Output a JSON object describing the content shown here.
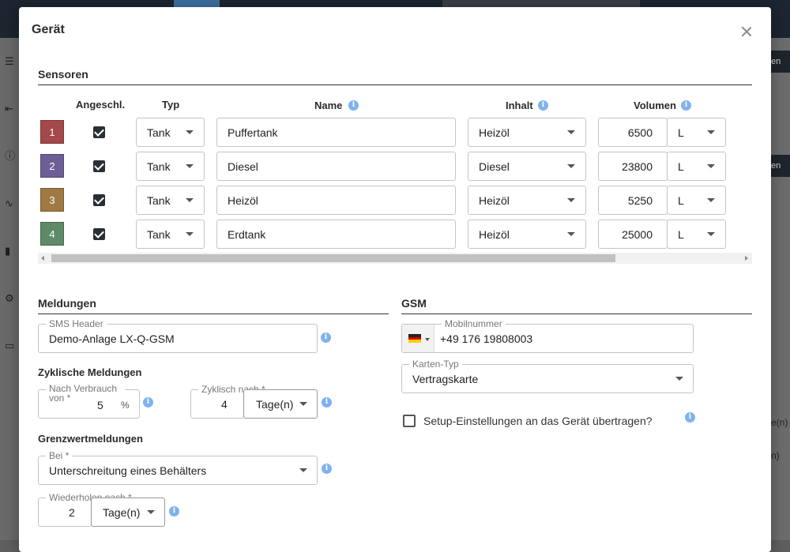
{
  "background": {
    "right_buttons": [
      "en",
      "en"
    ],
    "right_texts": [
      "e(n)",
      "n)"
    ],
    "sidebar_icons": [
      "list-icon",
      "collapse-icon",
      "info-icon",
      "trend-icon",
      "bar-chart-icon",
      "settings-icon",
      "screen-icon"
    ]
  },
  "dialog": {
    "title": "Gerät",
    "sensors": {
      "title": "Sensoren",
      "headers": {
        "connected": "Angeschl.",
        "type": "Typ",
        "name": "Name",
        "content": "Inhalt",
        "volume": "Volumen"
      },
      "rows": [
        {
          "number": "1",
          "color": "#a5484a",
          "connected": true,
          "type": "Tank",
          "name": "Puffertank",
          "content": "Heizöl",
          "volume": "6500",
          "unit": "L"
        },
        {
          "number": "2",
          "color": "#6e5e98",
          "connected": true,
          "type": "Tank",
          "name": "Diesel",
          "content": "Diesel",
          "volume": "23800",
          "unit": "L"
        },
        {
          "number": "3",
          "color": "#9e7a42",
          "connected": true,
          "type": "Tank",
          "name": "Heizöl",
          "content": "Heizöl",
          "volume": "5250",
          "unit": "L"
        },
        {
          "number": "4",
          "color": "#5f8a67",
          "connected": true,
          "type": "Tank",
          "name": "Erdtank",
          "content": "Heizöl",
          "volume": "25000",
          "unit": "L"
        }
      ]
    },
    "messages": {
      "title": "Meldungen",
      "sms_header": {
        "label": "SMS Header",
        "value": "Demo-Anlage LX-Q-GSM"
      },
      "cyclic": {
        "title": "Zyklische Meldungen",
        "after_consumption": {
          "label": "Nach Verbrauch von *",
          "value": "5",
          "unit": "%"
        },
        "cyclic_after": {
          "label": "Zyklisch nach *",
          "value": "4",
          "unit": "Tage(n)"
        }
      },
      "limits": {
        "title": "Grenzwertmeldungen",
        "at": {
          "label": "Bei *",
          "value": "Unterschreitung eines Behälters"
        },
        "repeat": {
          "label": "Wiederholen nach *",
          "value": "2",
          "unit": "Tage(n)"
        }
      }
    },
    "gsm": {
      "title": "GSM",
      "mobile": {
        "label": "Mobilnummer",
        "value": "+49 176 19808003",
        "country_flag": "de-flag-icon"
      },
      "card_type": {
        "label": "Karten-Typ",
        "value": "Vertragskarte"
      },
      "setup_transfer": {
        "label": "Setup-Einstellungen an das Gerät übertragen?",
        "checked": false
      }
    }
  },
  "colors": {
    "info": "#7fb2ee",
    "checkbox": "#2a2f36",
    "header_bg": "#1c2530"
  }
}
